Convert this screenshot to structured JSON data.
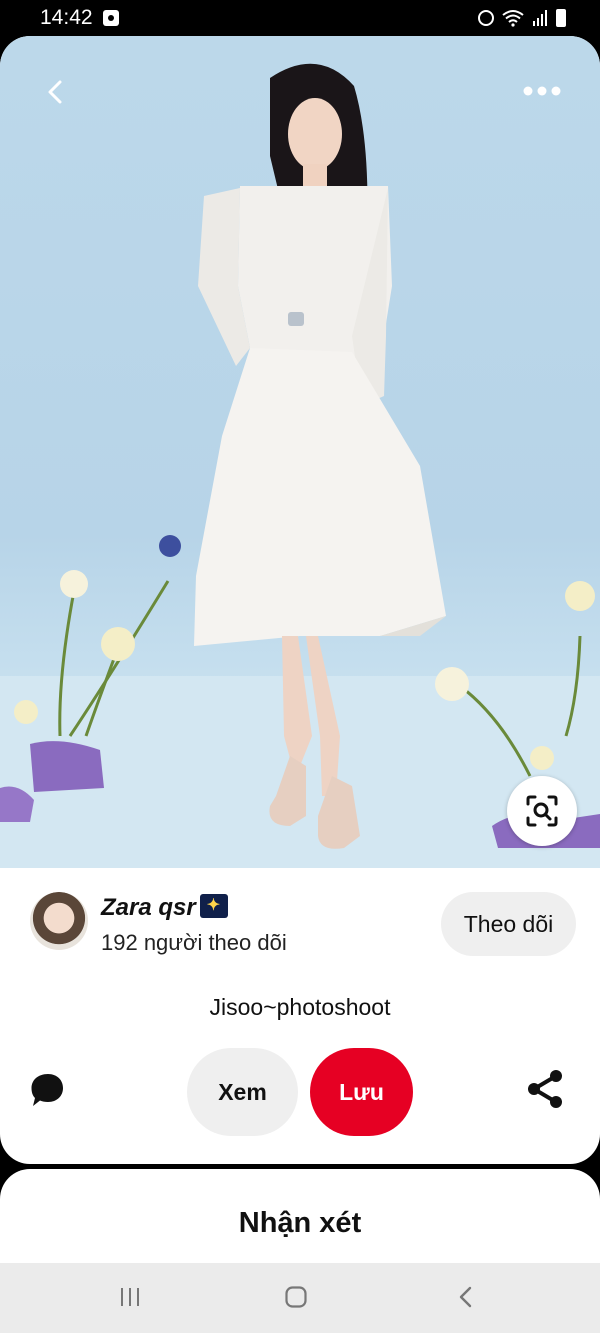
{
  "status_bar": {
    "time": "14:42"
  },
  "pin": {
    "image_description_icon": "photo",
    "creator": {
      "name": "Zara qsr",
      "followers": "192 người theo dõi",
      "follow_label": "Theo dõi"
    },
    "title": "Jisoo~photoshoot",
    "actions": {
      "view_label": "Xem",
      "save_label": "Lưu"
    }
  },
  "comments": {
    "title": "Nhận xét"
  },
  "colors": {
    "accent": "#e60023",
    "pill_bg": "#efefef"
  }
}
